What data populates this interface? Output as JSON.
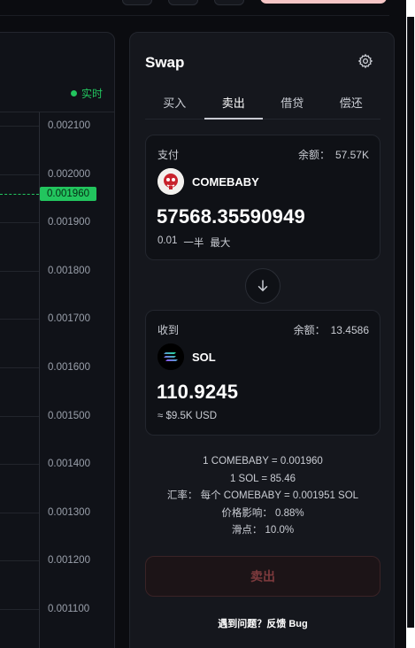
{
  "chart": {
    "live_label": "实时",
    "price_badge": "0.001960",
    "ticks": [
      "0.002100",
      "0.002000",
      "0.001900",
      "0.001800",
      "0.001700",
      "0.001600",
      "0.001500",
      "0.001400",
      "0.001300",
      "0.001200",
      "0.001100"
    ]
  },
  "swap": {
    "title": "Swap",
    "tabs": [
      "买入",
      "卖出",
      "借贷",
      "偿还"
    ],
    "active_tab": "卖出",
    "pay": {
      "label": "支付",
      "balance_label": "余额：",
      "balance_value": "57.57K",
      "token": "COMEBABY",
      "token_icon": "comebaby-token-icon",
      "amount": "57568.35590949",
      "quick": [
        "0.01",
        "一半",
        "最大"
      ]
    },
    "receive": {
      "label": "收到",
      "balance_label": "余额：",
      "balance_value": "13.4586",
      "token": "SOL",
      "token_icon": "sol-token-icon",
      "amount": "110.9245",
      "usd": "≈ $9.5K USD"
    },
    "info": [
      "1 COMEBABY = 0.001960",
      "1 SOL = 85.46",
      "汇率：  每个 COMEBABY = 0.001951 SOL",
      "价格影响：  0.88%",
      "滑点：  10.0%"
    ],
    "sell_button": "卖出",
    "bug_link": "遇到问题？反馈 Bug"
  },
  "colors": {
    "accent_green": "#22c55e",
    "sell_text": "#7d3a3d"
  }
}
